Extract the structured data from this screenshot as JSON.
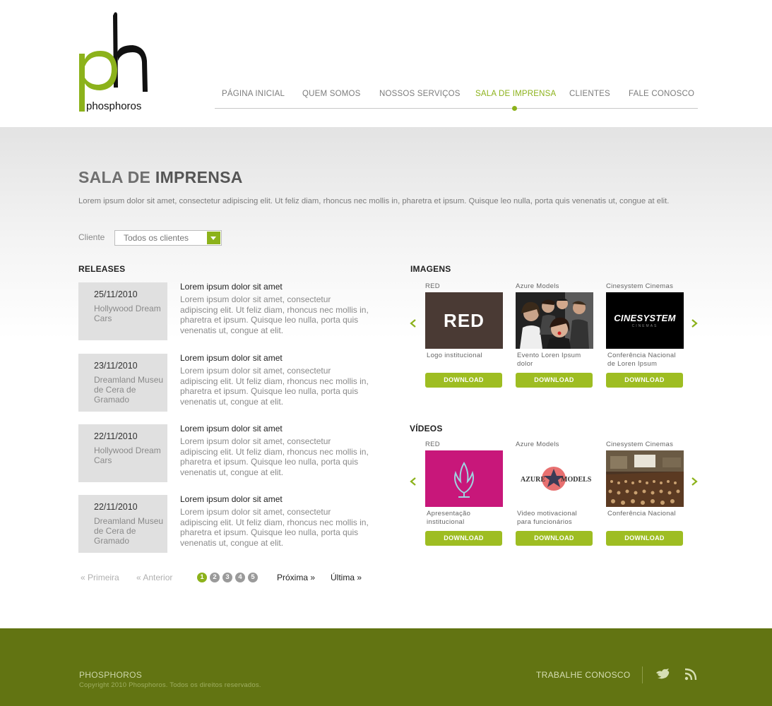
{
  "header": {
    "logo_text": "phosphoros",
    "nav": [
      {
        "label": "PÁGINA INICIAL",
        "active": false
      },
      {
        "label": "QUEM SOMOS",
        "active": false
      },
      {
        "label": "NOSSOS SERVIÇOS",
        "active": false
      },
      {
        "label": "SALA DE IMPRENSA",
        "active": true
      },
      {
        "label": "CLIENTES",
        "active": false
      },
      {
        "label": "FALE CONOSCO",
        "active": false
      }
    ]
  },
  "page": {
    "title_light": "SALA DE ",
    "title_bold": "IMPRENSA",
    "intro": "Lorem ipsum dolor sit amet, consectetur adipiscing elit. Ut feliz diam, rhoncus nec mollis in, pharetra et ipsum. Quisque leo nulla, porta quis venenatis ut, congue at elit.",
    "filter_label": "Cliente",
    "filter_value": "Todos os clientes"
  },
  "releases": {
    "heading": "RELEASES",
    "items": [
      {
        "date": "25/11/2010",
        "client": "Hollywood Dream Cars",
        "title": "Lorem ipsum dolor sit amet",
        "text": "Lorem ipsum dolor sit amet, consectetur adipiscing elit. Ut feliz diam, rhoncus nec mollis in, pharetra et ipsum. Quisque leo nulla, porta quis venenatis ut, congue at elit."
      },
      {
        "date": "23/11/2010",
        "client": "Dreamland Museu de Cera de Gramado",
        "title": "Lorem ipsum dolor sit amet",
        "text": "Lorem ipsum dolor sit amet, consectetur adipiscing elit. Ut feliz diam, rhoncus nec mollis in, pharetra et ipsum. Quisque leo nulla, porta quis venenatis ut, congue at elit."
      },
      {
        "date": "22/11/2010",
        "client": "Hollywood Dream Cars",
        "title": "Lorem ipsum dolor sit amet",
        "text": "Lorem ipsum dolor sit amet, consectetur adipiscing elit. Ut feliz diam, rhoncus nec mollis in, pharetra et ipsum. Quisque leo nulla, porta quis venenatis ut, congue at elit."
      },
      {
        "date": "22/11/2010",
        "client": "Dreamland Museu de Cera de Gramado",
        "title": "Lorem ipsum dolor sit amet",
        "text": "Lorem ipsum dolor sit amet, consectetur adipiscing elit. Ut feliz diam, rhoncus nec mollis in, pharetra et ipsum. Quisque leo nulla, porta quis venenatis ut, congue at elit."
      }
    ]
  },
  "pagination": {
    "first": "Primeira",
    "prev": "Anterior",
    "pages": [
      "1",
      "2",
      "3",
      "4",
      "5"
    ],
    "current": "1",
    "next": "Próxima",
    "last": "Última"
  },
  "images": {
    "heading": "IMAGENS",
    "items": [
      {
        "client": "RED",
        "thumb_text": "RED",
        "desc": "Logo institucional",
        "download": "DOWNLOAD"
      },
      {
        "client": "Azure Models",
        "thumb_text": "",
        "desc": "Evento Loren Ipsum dolor",
        "download": "DOWNLOAD"
      },
      {
        "client": "Cinesystem Cinemas",
        "thumb_text": "CINESYSTEM",
        "thumb_subtext": "CINEMAS",
        "desc": "Conferência Nacional de Loren Ipsum",
        "download": "DOWNLOAD"
      }
    ]
  },
  "videos": {
    "heading": "VÍDEOS",
    "items": [
      {
        "client": "RED",
        "desc": "Apresentação institucional",
        "download": "DOWNLOAD"
      },
      {
        "client": "Azure Models",
        "thumb_text_left": "AZURE",
        "thumb_text_right": "MODELS",
        "desc": "Video motivacional para funcionários",
        "download": "DOWNLOAD"
      },
      {
        "client": "Cinesystem Cinemas",
        "desc": "Conferência Nacional",
        "download": "DOWNLOAD"
      }
    ]
  },
  "footer": {
    "brand": "PHOSPHOROS",
    "copyright": "Copyright 2010 Phosphoros. Todos os direitos reservados.",
    "work_link": "TRABALHE CONOSCO"
  },
  "colors": {
    "accent": "#8cb21b",
    "download_button": "#9ebd22",
    "footer_bg": "#627412",
    "red_thumb": "#4a3a34",
    "video_red_thumb": "#c8177a"
  },
  "icons": {
    "twitter": "twitter-bird-icon",
    "rss": "rss-icon",
    "carousel_prev": "chevron-left-icon",
    "carousel_next": "chevron-right-icon",
    "select_arrow": "chevron-down-icon"
  }
}
